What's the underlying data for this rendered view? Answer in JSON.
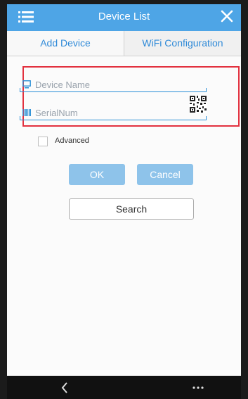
{
  "header": {
    "title": "Device List"
  },
  "tabs": [
    {
      "label": "Add Device"
    },
    {
      "label": "WiFi Configuration"
    }
  ],
  "form": {
    "device_name_placeholder": "Device Name",
    "serial_placeholder": "SerialNum",
    "advanced_label": "Advanced",
    "ok_label": "OK",
    "cancel_label": "Cancel",
    "search_label": "Search"
  },
  "colors": {
    "accent": "#4ea5e6",
    "highlight": "#e2313f",
    "button": "#8ec3ea"
  },
  "icons": {
    "menu": "menu-icon",
    "close": "close-icon",
    "monitor": "monitor-icon",
    "barcode": "barcode-icon",
    "qr": "qr-code-icon",
    "back": "back-icon",
    "more": "more-icon"
  }
}
